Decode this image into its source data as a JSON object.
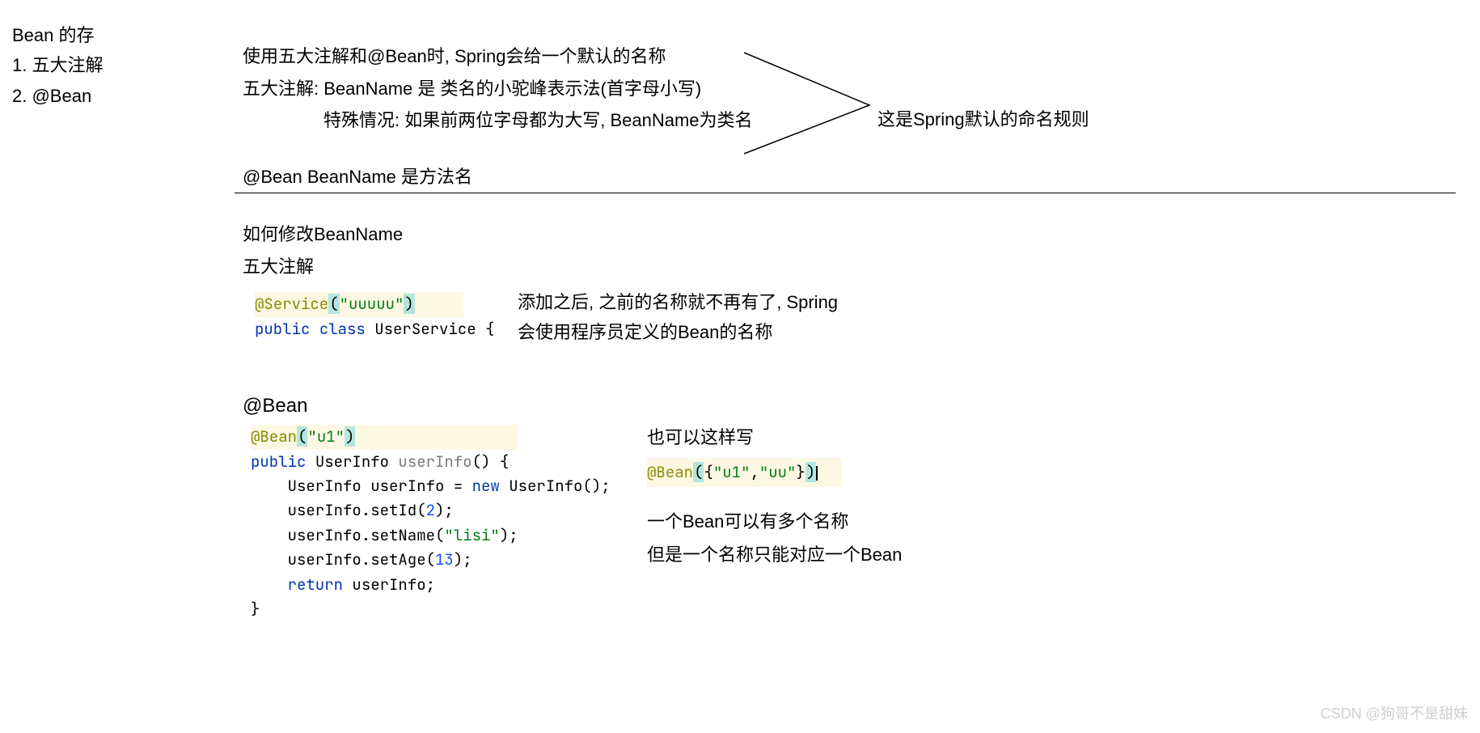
{
  "sidebar": {
    "title": "Bean 的存",
    "items": [
      "1. 五大注解",
      "2. @Bean"
    ]
  },
  "top": {
    "l1": "使用五大注解和@Bean时, Spring会给一个默认的名称",
    "l2": "五大注解: BeanName 是 类名的小驼峰表示法(首字母小写)",
    "l3": "特殊情况: 如果前两位字母都为大写, BeanName为类名",
    "l4": "@Bean   BeanName 是方法名",
    "right_note": "这是Spring默认的命名规则"
  },
  "sec2": {
    "h1": "如何修改BeanName",
    "h2": "五大注解",
    "code": {
      "ann": "@Service",
      "arg": "\"uuuuu\"",
      "kw_public": "public",
      "kw_class": "class",
      "cls": "UserService {"
    },
    "note_a": "添加之后, 之前的名称就不再有了, Spring",
    "note_b": "会使用程序员定义的Bean的名称"
  },
  "sec3": {
    "h1": "@Bean",
    "code": {
      "ann": "@Bean",
      "arg": "\"u1\"",
      "kw_public": "public",
      "type": "UserInfo",
      "method": "userInfo",
      "brace_open": "() {",
      "l1a": "UserInfo userInfo = ",
      "l1_new": "new",
      "l1b": " UserInfo();",
      "l2a": "userInfo.setId(",
      "l2n": "2",
      "l2b": ");",
      "l3a": "userInfo.setName(",
      "l3s": "\"lisi\"",
      "l3b": ");",
      "l4a": "userInfo.setAge(",
      "l4n": "13",
      "l4b": ");",
      "l5_ret": "return",
      "l5b": " userInfo;",
      "brace_close": "}"
    },
    "right": {
      "also": "也可以这样写",
      "code_ann": "@Bean",
      "code_body": "({\"u1\",\"uu\"})",
      "n1": "一个Bean可以有多个名称",
      "n2": "但是一个名称只能对应一个Bean"
    }
  },
  "watermark": "CSDN @狗哥不是甜妹"
}
